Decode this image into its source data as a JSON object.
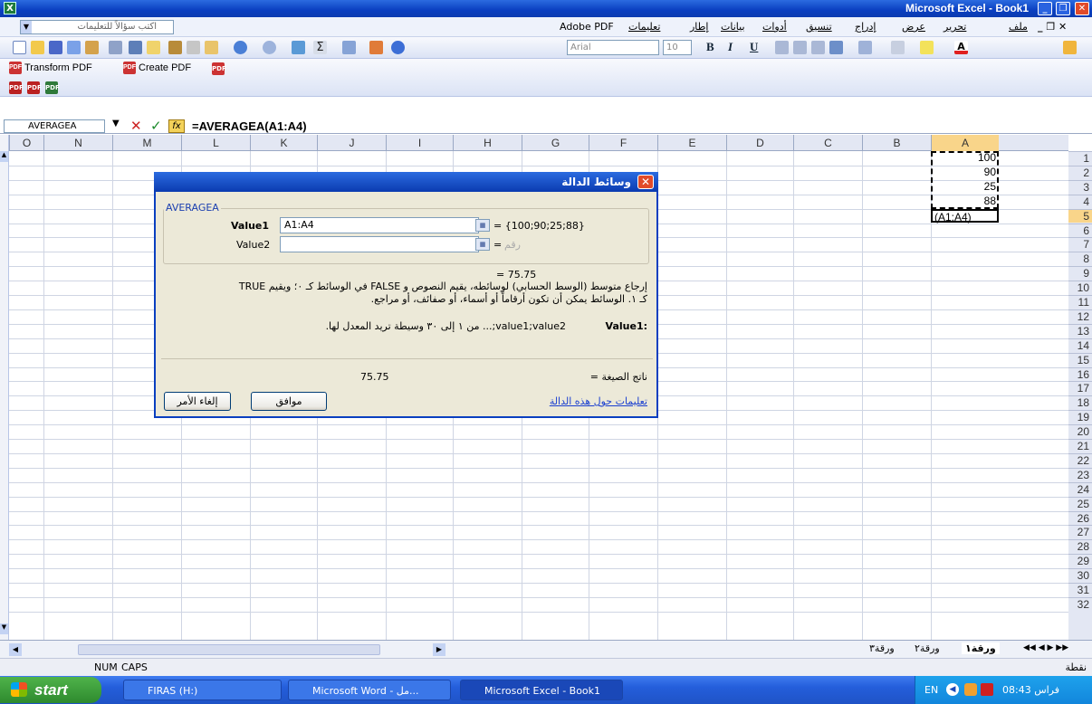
{
  "window": {
    "title": "Microsoft Excel - Book1",
    "app_icon": "excel-icon",
    "minimize": "_",
    "restore": "❐",
    "close": "✕"
  },
  "menu": {
    "items": [
      "ملف",
      "تحرير",
      "عرض",
      "إدراج",
      "تنسيق",
      "أدوات",
      "بيانات",
      "إطار",
      "تعليمات",
      "Adobe PDF"
    ],
    "ask_placeholder": "اكتب سؤالاً للتعليمات",
    "doc_controls": "_ ❐ ✕"
  },
  "formatting": {
    "font": "Arial",
    "size": "10"
  },
  "pdf_toolbar": {
    "transform": "Transform PDF",
    "create": "Create PDF"
  },
  "formula_bar": {
    "name_box": "AVERAGEA",
    "formula": "=AVERAGEA(A1:A4)",
    "fx": "fx"
  },
  "columns": [
    "O",
    "N",
    "M",
    "L",
    "K",
    "J",
    "I",
    "H",
    "G",
    "F",
    "E",
    "D",
    "C",
    "B",
    "A"
  ],
  "rows": [
    "1",
    "2",
    "3",
    "4",
    "5",
    "6",
    "7",
    "8",
    "9",
    "10",
    "11",
    "12",
    "13",
    "14",
    "15",
    "16",
    "17",
    "18",
    "19",
    "20",
    "21",
    "22",
    "23",
    "24",
    "25",
    "26",
    "27",
    "28",
    "29",
    "30",
    "31",
    "32"
  ],
  "cells": {
    "A1": "100",
    "A2": "90",
    "A3": "25",
    "A4": "88",
    "A5": "(A1:A4)"
  },
  "dialog": {
    "title": "وسائط الدالة",
    "group": "AVERAGEA",
    "value1_label": "Value1",
    "value1": "A1:A4",
    "value1_result": "= {100;90;25;88}",
    "value2_label": "Value2",
    "value2_hint": "رقم",
    "result": "= 75.75",
    "description_line1": "إرجاع متوسط (الوسط الحسابي) لوسائطه، يقيم النصوص و FALSE في الوسائط كـ ٠؛ ويقيم TRUE",
    "description_line2": "كـ ١. الوسائط يمكن أن تكون أرقاماً أو أسماء، أو صفائف، أو مراجع.",
    "arg_label": "Value1:",
    "arg_help": "value1;value2;... من ١ إلى ٣٠ وسيطة تريد المعدل لها.",
    "formula_result_label": "ناتج الصيغة =",
    "formula_result": "75.75",
    "help_link": "تعليمات حول هذه الدالة",
    "ok": "موافق",
    "cancel": "إلغاء الأمر"
  },
  "sheet_tabs": [
    "ورقة١",
    "ورقة٢",
    "ورقة٣"
  ],
  "status": {
    "mode": "نقطة",
    "num": "NUM",
    "caps": "CAPS"
  },
  "taskbar": {
    "start": "start",
    "tasks": [
      "FIRAS (H:)",
      "Microsoft Word - مل...",
      "Microsoft Excel - Book1"
    ],
    "lang": "EN",
    "time": "08:43 فراس"
  }
}
